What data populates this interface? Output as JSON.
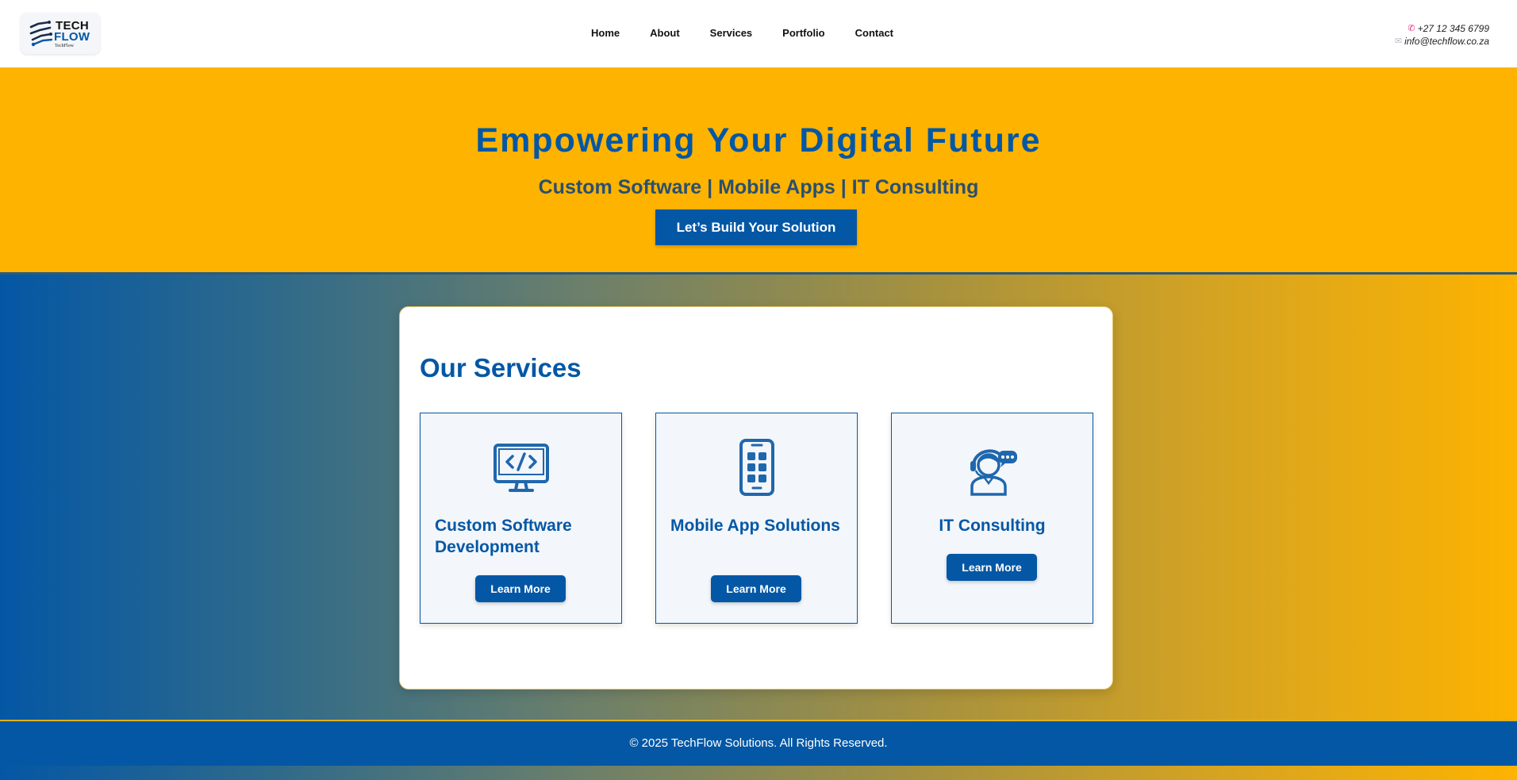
{
  "header": {
    "logo": {
      "line1": "TECH",
      "line2": "FLOW",
      "tagline": "TechFlow"
    },
    "nav": [
      "Home",
      "About",
      "Services",
      "Portfolio",
      "Contact"
    ],
    "contact": {
      "phone": "+27 12 345 6799",
      "email": "info@techflow.co.za",
      "phone_icon": "phone-icon",
      "email_icon": "envelope-icon"
    }
  },
  "hero": {
    "title": "Empowering Your Digital Future",
    "subtitle": "Custom Software | Mobile Apps | IT Consulting",
    "cta_label": "Let’s Build Your Solution"
  },
  "services": {
    "heading": "Our Services",
    "items": [
      {
        "title": "Custom Software Development",
        "icon": "monitor-code-icon",
        "button": "Learn More"
      },
      {
        "title": "Mobile App Solutions",
        "icon": "mobile-app-icon",
        "button": "Learn More"
      },
      {
        "title": "IT Consulting",
        "icon": "consultant-headset-icon",
        "button": "Learn More"
      }
    ]
  },
  "footer": {
    "text": "© 2025 TechFlow Solutions. All Rights Reserved."
  },
  "colors": {
    "primary": "#0457a5",
    "accent": "#fdb300",
    "subtitle": "#2b4f6e"
  }
}
